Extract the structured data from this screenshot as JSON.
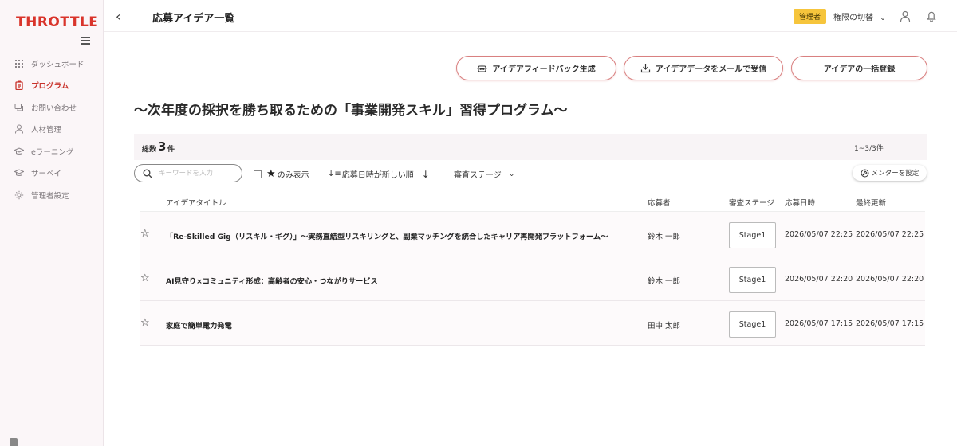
{
  "sidebar": {
    "logo": "THROTTLE",
    "items": [
      {
        "label": "ダッシュボード",
        "icon": "grid-icon"
      },
      {
        "label": "プログラム",
        "icon": "clipboard-icon",
        "active": true
      },
      {
        "label": "お問い合わせ",
        "icon": "chat-icon"
      },
      {
        "label": "人材管理",
        "icon": "person-icon"
      },
      {
        "label": "eラーニング",
        "icon": "graduation-cap-icon"
      },
      {
        "label": "サーベイ",
        "icon": "cap-icon"
      },
      {
        "label": "管理者設定",
        "icon": "gear-icon"
      }
    ]
  },
  "header": {
    "title": "応募アイデア一覧",
    "role_badge": "管理者",
    "switch_label": "権限の切替"
  },
  "actions": {
    "feedback": "アイデアフィードバック生成",
    "email": "アイデアデータをメールで受信",
    "bulk": "アイデアの一括登録"
  },
  "program_title": "〜次年度の採択を勝ち取るための「事業開発スキル」習得プログラム〜",
  "summary": {
    "count_label": "総数",
    "count": "3",
    "count_unit": "件",
    "range": "1~3/3件"
  },
  "toolbar": {
    "search_placeholder": "キーワードを入力",
    "star_only": "のみ表示",
    "sort_label": "応募日時が新しい順",
    "stage_filter": "審査ステージ",
    "mentor_button": "メンターを設定"
  },
  "table": {
    "headers": {
      "title": "アイデアタイトル",
      "applicant": "応募者",
      "stage": "審査ステージ",
      "applied": "応募日時",
      "updated": "最終更新"
    },
    "rows": [
      {
        "title": "「Re-Skilled Gig（リスキル・ギグ）」〜実務直結型リスキリングと、副業マッチングを統合したキャリア再開発プラットフォーム〜",
        "applicant": "鈴木 一郎",
        "stage": "Stage1",
        "applied": "2026/05/07 22:25",
        "updated": "2026/05/07 22:25"
      },
      {
        "title": "AI見守り×コミュニティ形成：高齢者の安心・つながりサービス",
        "applicant": "鈴木 一郎",
        "stage": "Stage1",
        "applied": "2026/05/07 22:20",
        "updated": "2026/05/07 22:20"
      },
      {
        "title": "家庭で簡単電力発電",
        "applicant": "田中 太郎",
        "stage": "Stage1",
        "applied": "2026/05/07 17:15",
        "updated": "2026/05/07 17:15"
      }
    ]
  },
  "colors": {
    "brand": "#d9342b",
    "badge": "#f6c53c"
  }
}
